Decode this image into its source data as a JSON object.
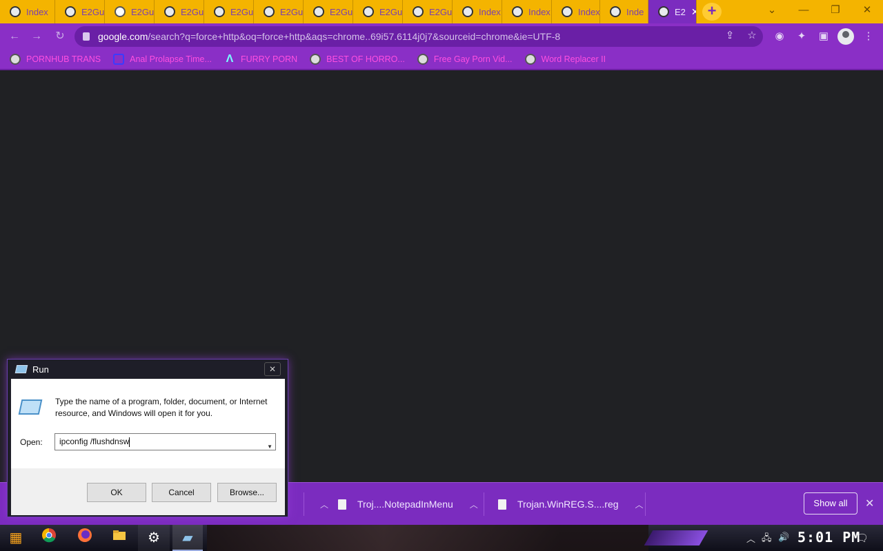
{
  "browser": {
    "tabs": [
      {
        "label": "Index",
        "icon": "extension-icon"
      },
      {
        "label": "E2Gu",
        "icon": "extension-icon"
      },
      {
        "label": "E2Gu",
        "icon": "globe-icon"
      },
      {
        "label": "E2Gu",
        "icon": "extension-icon"
      },
      {
        "label": "E2Gu",
        "icon": "extension-icon"
      },
      {
        "label": "E2Gu",
        "icon": "extension-icon"
      },
      {
        "label": "E2Gu",
        "icon": "extension-icon"
      },
      {
        "label": "E2Gu",
        "icon": "extension-icon"
      },
      {
        "label": "E2Gu",
        "icon": "extension-icon"
      },
      {
        "label": "Index",
        "icon": "extension-icon"
      },
      {
        "label": "Index",
        "icon": "extension-icon"
      },
      {
        "label": "Index",
        "icon": "extension-icon"
      },
      {
        "label": "Inde",
        "icon": "extension-icon"
      },
      {
        "label": "E2",
        "icon": "extension-icon",
        "active": true
      }
    ],
    "new_tab_glyph": "+",
    "address": {
      "host": "google.com",
      "path": "/search?q=force+http&oq=force+http&aqs=chrome..69i57.6114j0j7&sourceid=chrome&ie=UTF-8"
    },
    "bookmarks": [
      {
        "label": "PORNHUB TRANS",
        "icon": "globe-icon"
      },
      {
        "label": "Anal Prolapse Time...",
        "icon": "bookmark-square-icon"
      },
      {
        "label": "FURRY PORN",
        "icon": "lambda-icon"
      },
      {
        "label": "BEST OF HORRO...",
        "icon": "globe-icon"
      },
      {
        "label": "Free Gay Porn Vid...",
        "icon": "extension-icon"
      },
      {
        "label": "Word Replacer II",
        "icon": "wr-icon"
      }
    ],
    "colors": {
      "tabstrip": "#f4b400",
      "toolbar": "#8a2fc6",
      "bookmark_text": "#ff4fe0",
      "content_bg": "#202124"
    }
  },
  "downloads": {
    "items": [
      {
        "label": "Troj....NotepadInMenu"
      },
      {
        "label": "Trojan.WinREG.S....reg"
      }
    ],
    "show_all": "Show all"
  },
  "run_dialog": {
    "title": "Run",
    "description": "Type the name of a program, folder, document, or Internet resource, and Windows will open it for you.",
    "open_label": "Open:",
    "input_value": "ipconfig /flushdnsw",
    "buttons": {
      "ok": "OK",
      "cancel": "Cancel",
      "browse": "Browse..."
    }
  },
  "taskbar": {
    "clock": "5:01 PM"
  }
}
